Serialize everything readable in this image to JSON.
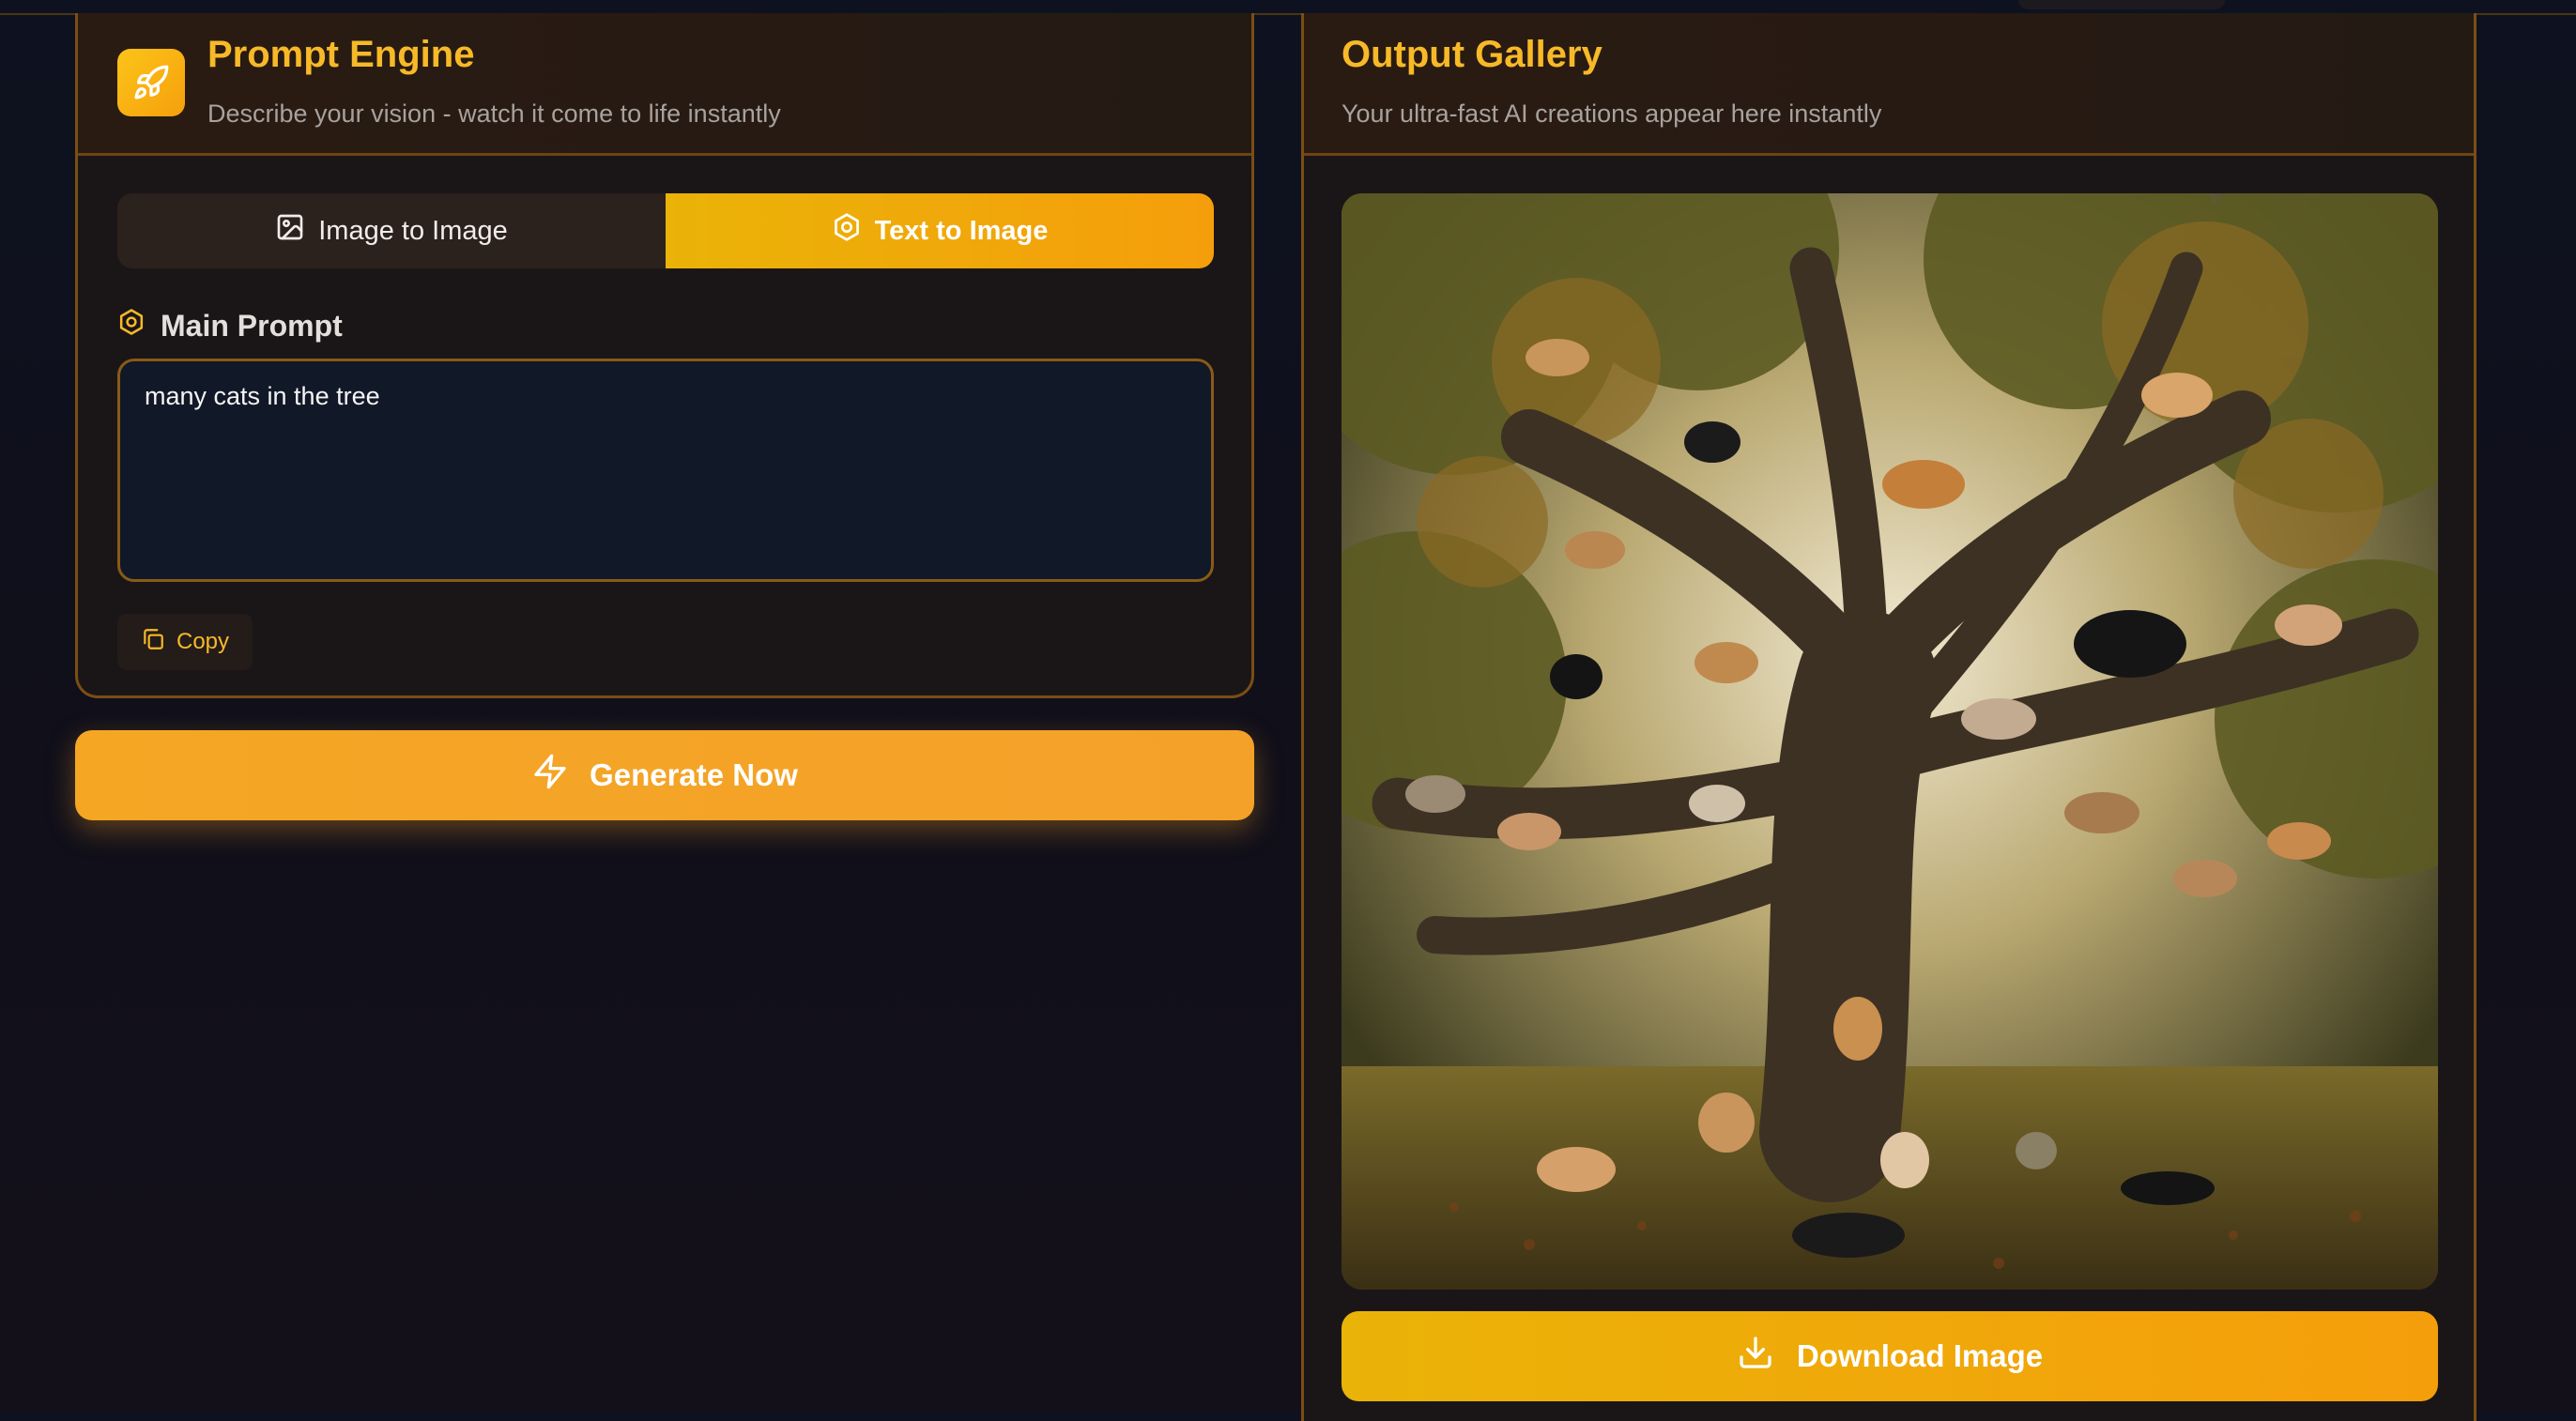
{
  "prompt_panel": {
    "title": "Prompt Engine",
    "subtitle": "Describe your vision - watch it come to life instantly",
    "logo_icon": "rocket-icon",
    "tabs": [
      {
        "label": "Image to Image",
        "icon": "image-icon",
        "active": false
      },
      {
        "label": "Text to Image",
        "icon": "hexagon-icon",
        "active": true
      }
    ],
    "main_prompt_label": "Main Prompt",
    "prompt_value": "many cats in the tree",
    "copy_label": "Copy"
  },
  "generate_button": {
    "label": "Generate Now",
    "icon": "zap-icon"
  },
  "gallery_panel": {
    "title": "Output Gallery",
    "subtitle": "Your ultra-fast AI creations appear here instantly",
    "download_label": "Download Image",
    "download_icon": "download-icon"
  },
  "colors": {
    "accent": "#f7b928",
    "accent_gradient_start": "#eab308",
    "accent_gradient_end": "#f59e0b",
    "panel_border": "#7a4e14",
    "input_bg": "#111827"
  }
}
